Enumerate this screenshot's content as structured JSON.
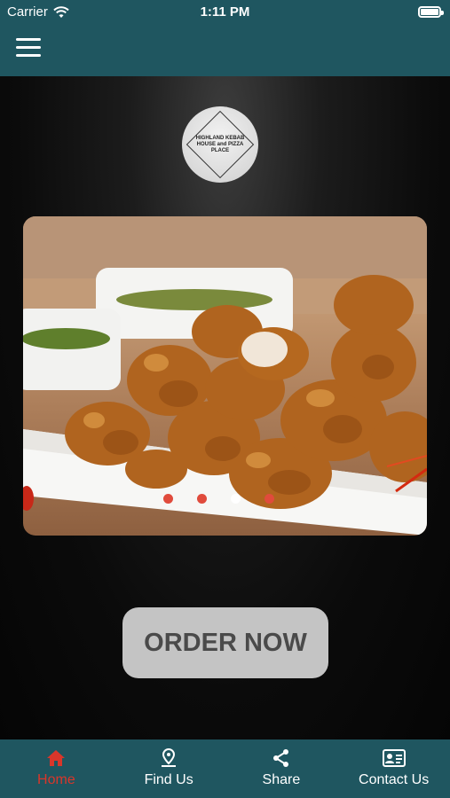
{
  "status_bar": {
    "carrier": "Carrier",
    "time": "1:11 PM"
  },
  "header": {
    "menu_icon": "hamburger-menu-icon"
  },
  "logo": {
    "text": "HIGHLAND KEBAB HOUSE and PIZZA PLACE"
  },
  "slider": {
    "image": "fried pakora / chicken pieces on a white plate with green chutney",
    "slide_count": 4,
    "active_slide": 3
  },
  "main": {
    "order_button": "ORDER NOW"
  },
  "tabs": [
    {
      "label": "Home",
      "icon": "home-icon",
      "active": true
    },
    {
      "label": "Find Us",
      "icon": "location-pin-icon",
      "active": false
    },
    {
      "label": "Share",
      "icon": "share-icon",
      "active": false
    },
    {
      "label": "Contact Us",
      "icon": "contact-card-icon",
      "active": false
    }
  ],
  "colors": {
    "bar": "#1f5660",
    "active_tab": "#d9362a",
    "button": "#c4c4c4",
    "dot": "#e04b3c"
  }
}
